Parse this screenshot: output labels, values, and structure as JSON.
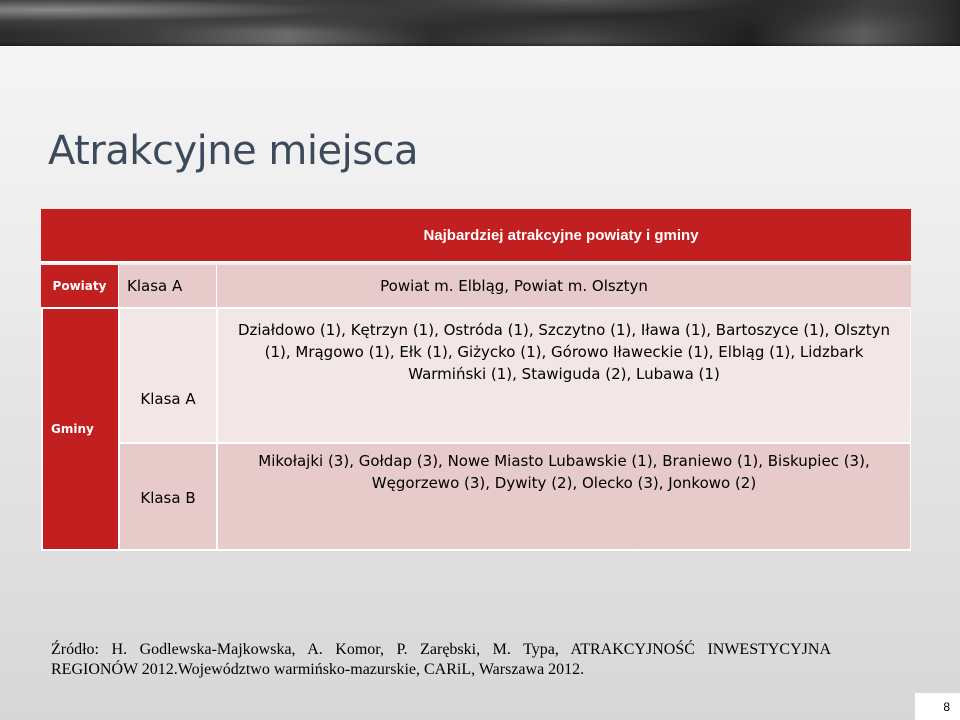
{
  "slide": {
    "title": "Atrakcyjne miejsca",
    "page_number": "8"
  },
  "table": {
    "header": "Najbardziej atrakcyjne powiaty i gminy",
    "powiaty": {
      "label": "Powiaty",
      "klasa": "Klasa A",
      "value": "Powiat m. Elbląg, Powiat m. Olsztyn"
    },
    "gminy": {
      "label": "Gminy",
      "klasa_a": {
        "klasa": "Klasa A",
        "value": "Działdowo (1), Kętrzyn (1), Ostróda (1), Szczytno (1), Iława (1), Bartoszyce (1), Olsztyn (1), Mrągowo (1), Ełk (1), Giżycko (1), Górowo Iławeckie (1), Elbląg (1), Lidzbark Warmiński (1), Stawiguda (2), Lubawa (1)"
      },
      "klasa_b": {
        "klasa": "Klasa B",
        "value": "Mikołajki (3), Gołdap (3), Nowe Miasto Lubawskie (1), Braniewo (1), Biskupiec (3), Węgorzewo (3), Dywity (2), Olecko (3), Jonkowo (2)"
      }
    }
  },
  "source": "Źródło: H. Godlewska-Majkowska, A. Komor, P. Zarębski, M. Typa, ATRAKCYJNOŚĆ INWESTYCYJNA REGIONÓW 2012.Województwo warmińsko-mazurskie, CARiL, Warszawa 2012.",
  "colors": {
    "accent_red": "#c21f20",
    "row_pink": "#e7caca",
    "row_light": "#f2e6e6",
    "title_color": "#3c4a5c"
  }
}
